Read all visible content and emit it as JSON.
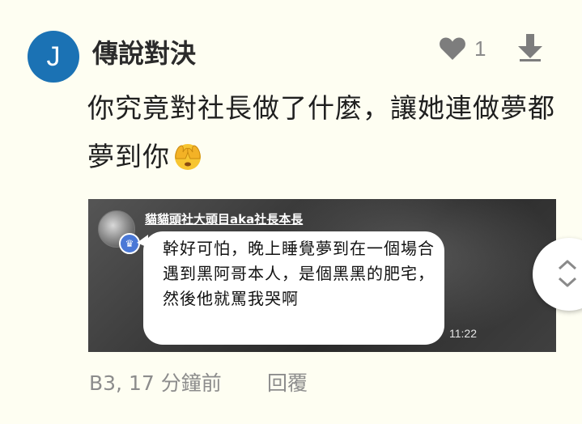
{
  "comment": {
    "avatar_initial": "J",
    "author": "傳說對決",
    "like_count": "1",
    "text": "你究竟對社長做了什麼，讓她連做夢都夢到你",
    "emoji_icon": "see-no-evil-face-icon",
    "meta": "B3, 17 分鐘前",
    "reply_label": "回覆"
  },
  "attachment": {
    "sender_name": "貓貓頭社大頭目aka社長本長",
    "message": "幹好可怕，晚上睡覺夢到在一個場合遇到黑阿哥本人，是個黑黑的肥宅，然後他就罵我哭啊",
    "time": "11:22"
  },
  "colors": {
    "background": "#fefef2",
    "avatar": "#1b72b4",
    "muted_text": "#8c8c8c",
    "icon_gray": "#7d7d7d"
  }
}
